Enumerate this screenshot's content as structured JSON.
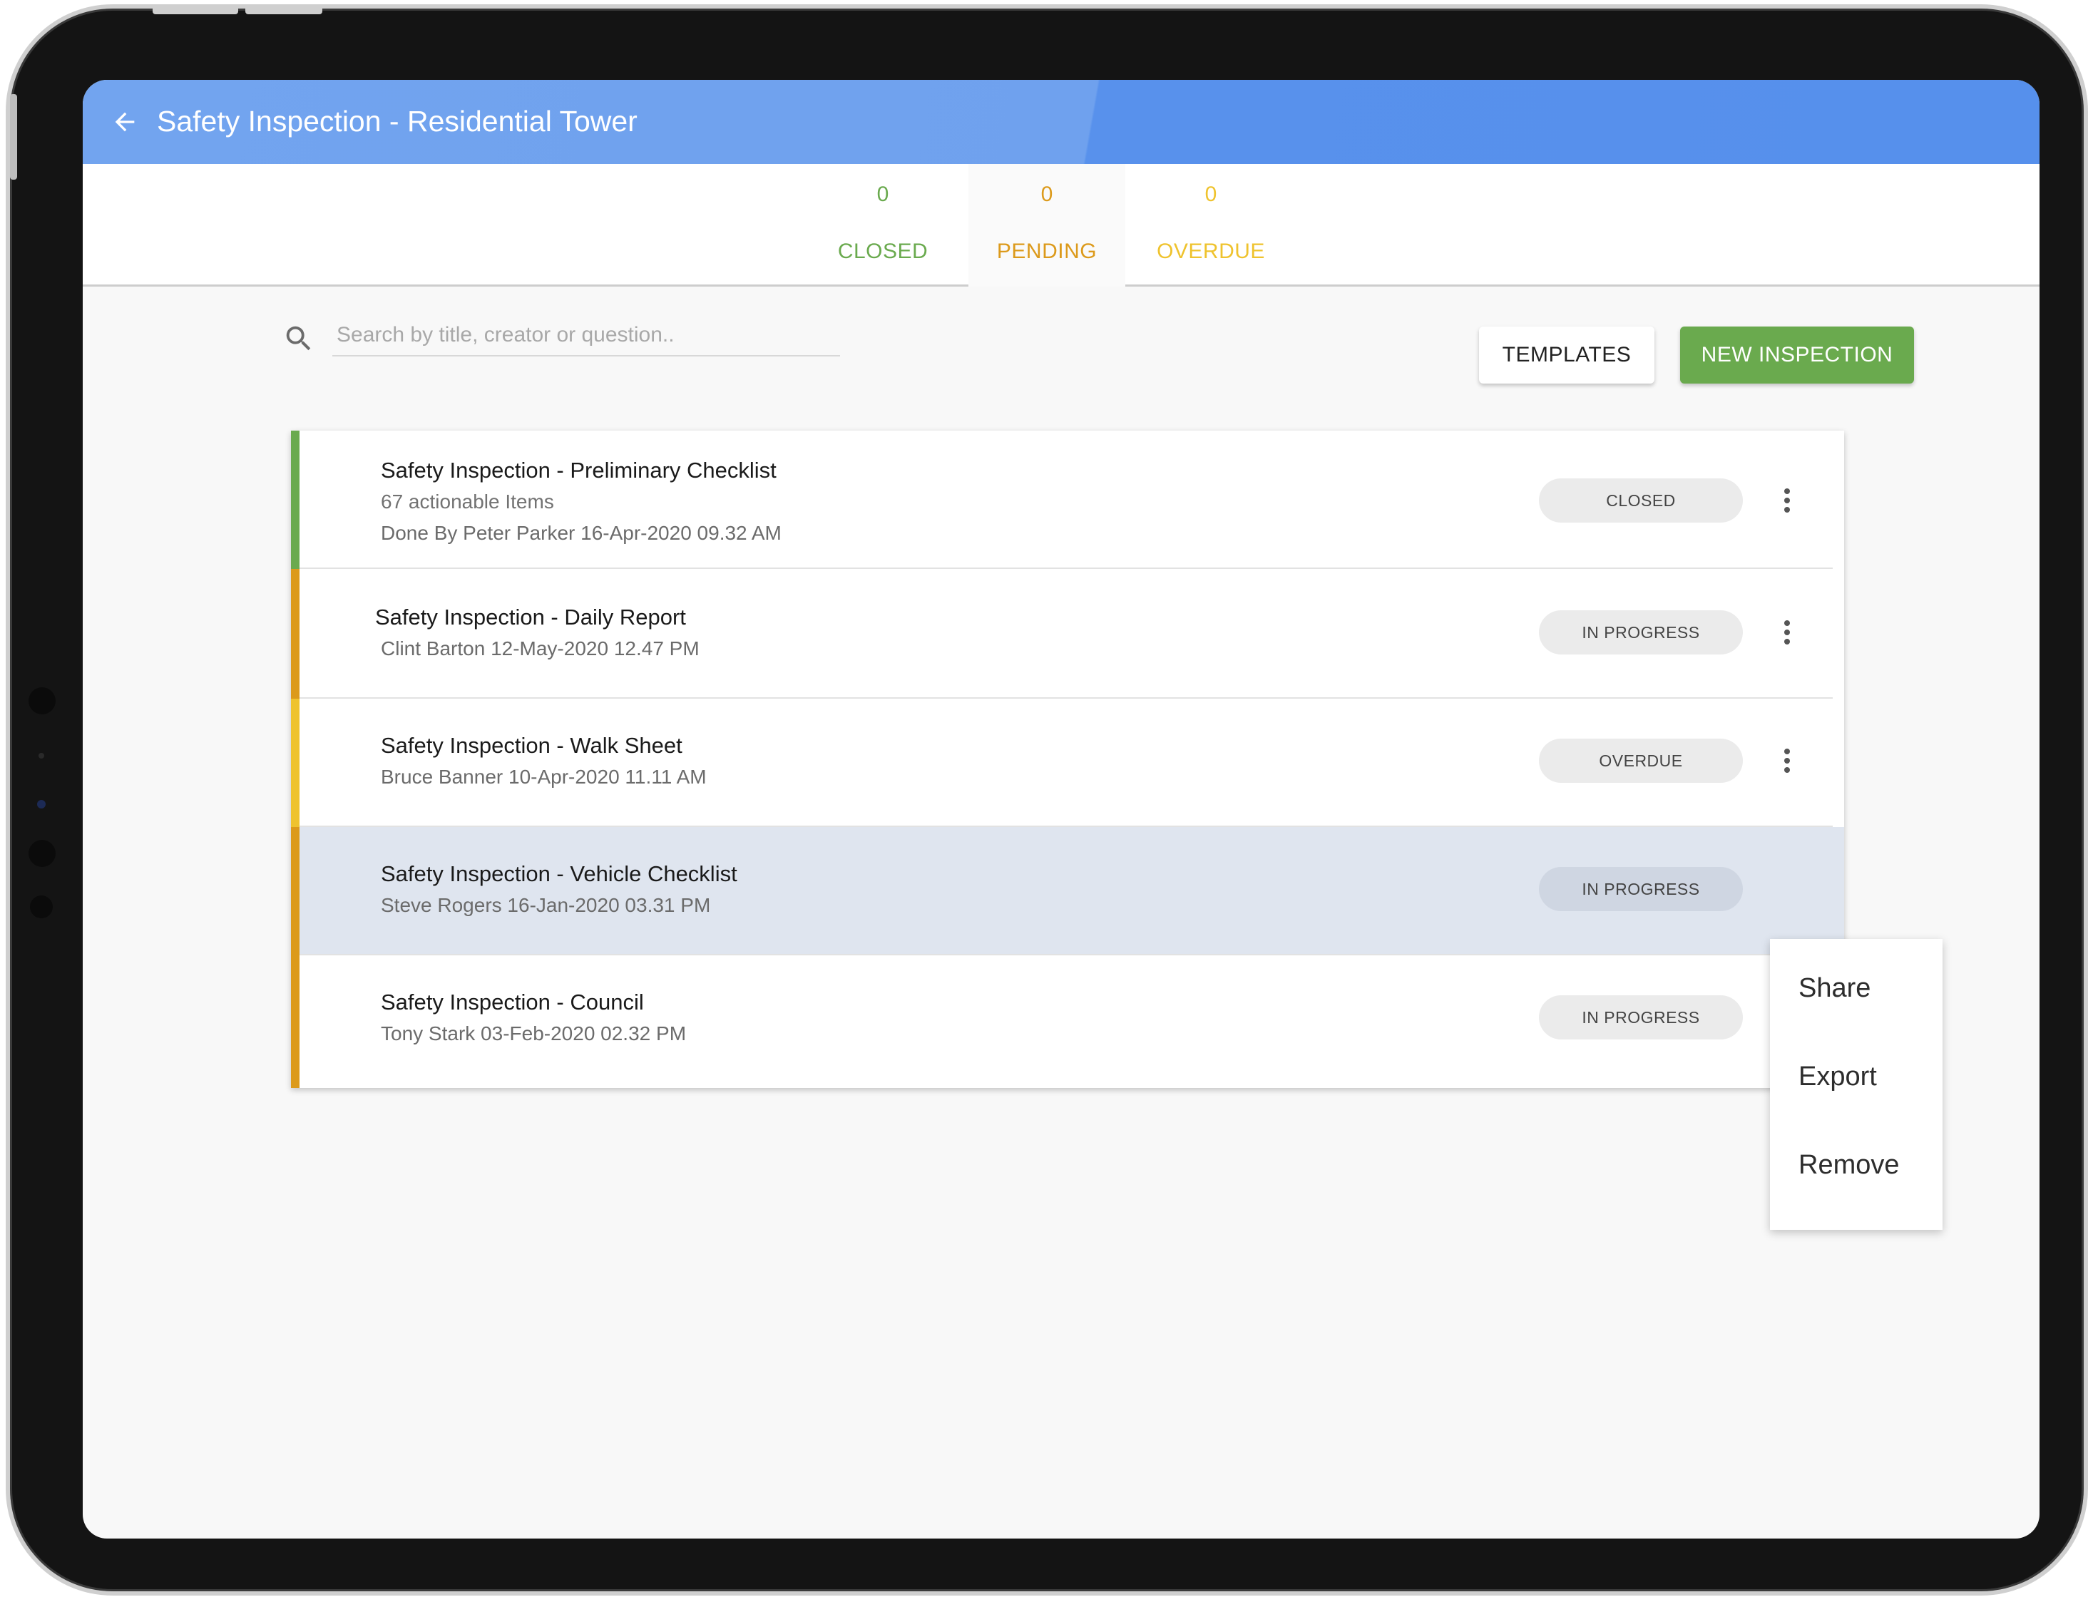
{
  "app_bar": {
    "title": "Safety Inspection - Residential Tower",
    "back_icon": "arrow-left-icon",
    "colors": {
      "left": "#72a4ef",
      "right": "#5690ec"
    }
  },
  "stats": [
    {
      "count": "0",
      "label": "CLOSED",
      "color": "#6aaa4e"
    },
    {
      "count": "0",
      "label": "PENDING",
      "color": "#dc9a1b",
      "active": true
    },
    {
      "count": "0",
      "label": "OVERDUE",
      "color": "#efc32e"
    }
  ],
  "search": {
    "placeholder": "Search by title, creator or question..",
    "value": "",
    "icon": "search-icon"
  },
  "actions": {
    "templates_label": "TEMPLATES",
    "new_label": "NEW INSPECTION",
    "new_color": "#6aaa4e"
  },
  "inspections": [
    {
      "title": "Safety Inspection - Preliminary Checklist",
      "subtitle": "67 actionable Items",
      "meta": "Done By Peter Parker 16-Apr-2020 09.32 AM",
      "status": "CLOSED",
      "accent": "#6aaa4e"
    },
    {
      "title": "Safety Inspection - Daily Report",
      "meta": "Clint Barton 12-May-2020 12.47 PM",
      "status": "IN PROGRESS",
      "accent": "#dc9a1b"
    },
    {
      "title": "Safety Inspection - Walk Sheet",
      "meta": "Bruce Banner 10-Apr-2020 11.11 AM",
      "status": "OVERDUE",
      "accent": "#efc32e"
    },
    {
      "title": "Safety Inspection - Vehicle Checklist",
      "meta": "Steve Rogers 16-Jan-2020 03.31 PM",
      "status": "IN PROGRESS",
      "accent": "#dc9a1b",
      "selected": true
    },
    {
      "title": "Safety Inspection - Council",
      "meta": "Tony Stark 03-Feb-2020 02.32 PM",
      "status": "IN PROGRESS",
      "accent": "#dc9a1b"
    }
  ],
  "context_menu": {
    "items": [
      "Share",
      "Export",
      "Remove"
    ]
  }
}
